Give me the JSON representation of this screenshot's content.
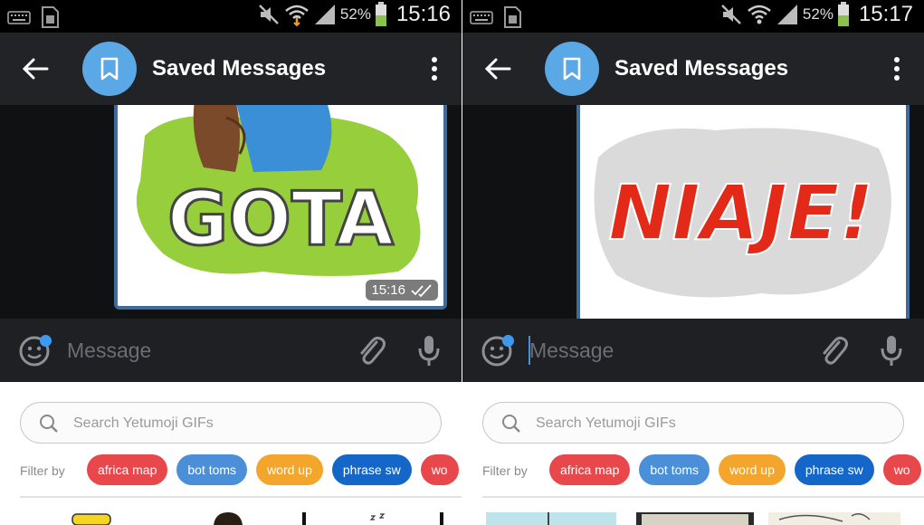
{
  "screens": [
    {
      "status": {
        "battery_percent": "52%",
        "time": "15:16"
      },
      "header": {
        "title": "Saved Messages"
      },
      "message": {
        "time": "15:16",
        "sticker_text": "GOTA"
      },
      "composer": {
        "placeholder": "Message"
      },
      "gif_panel": {
        "search_placeholder": "Search Yetumoji GIFs",
        "filter_label": "Filter by",
        "chips": [
          {
            "label": "africa map",
            "color": "#e8474b"
          },
          {
            "label": "bot toms",
            "color": "#4a8fd8"
          },
          {
            "label": "word up",
            "color": "#f3a52c"
          },
          {
            "label": "phrase sw",
            "color": "#1467c9"
          },
          {
            "label": "wo",
            "color": "#e8474b"
          }
        ]
      }
    },
    {
      "status": {
        "battery_percent": "52%",
        "time": "15:17"
      },
      "header": {
        "title": "Saved Messages"
      },
      "message": {
        "sticker_text": "NIAJE!"
      },
      "composer": {
        "placeholder": "Message"
      },
      "gif_panel": {
        "search_placeholder": "Search Yetumoji GIFs",
        "filter_label": "Filter by",
        "chips": [
          {
            "label": "africa map",
            "color": "#e8474b"
          },
          {
            "label": "bot toms",
            "color": "#4a8fd8"
          },
          {
            "label": "word up",
            "color": "#f3a52c"
          },
          {
            "label": "phrase sw",
            "color": "#1467c9"
          },
          {
            "label": "wo",
            "color": "#e8474b"
          }
        ]
      }
    }
  ],
  "icons": [
    "keyboard-icon",
    "sim-card-icon",
    "mute-icon",
    "wifi-icon",
    "signal-icon",
    "battery-icon",
    "back-arrow-icon",
    "bookmark-icon",
    "more-vert-icon",
    "double-check-icon",
    "emoji-icon",
    "attach-icon",
    "mic-icon",
    "search-icon"
  ],
  "colors": {
    "avatar": "#5aa9e6",
    "card_border": "#3f6a99",
    "battery": "#8bc34a",
    "caret": "#4a90d9"
  }
}
